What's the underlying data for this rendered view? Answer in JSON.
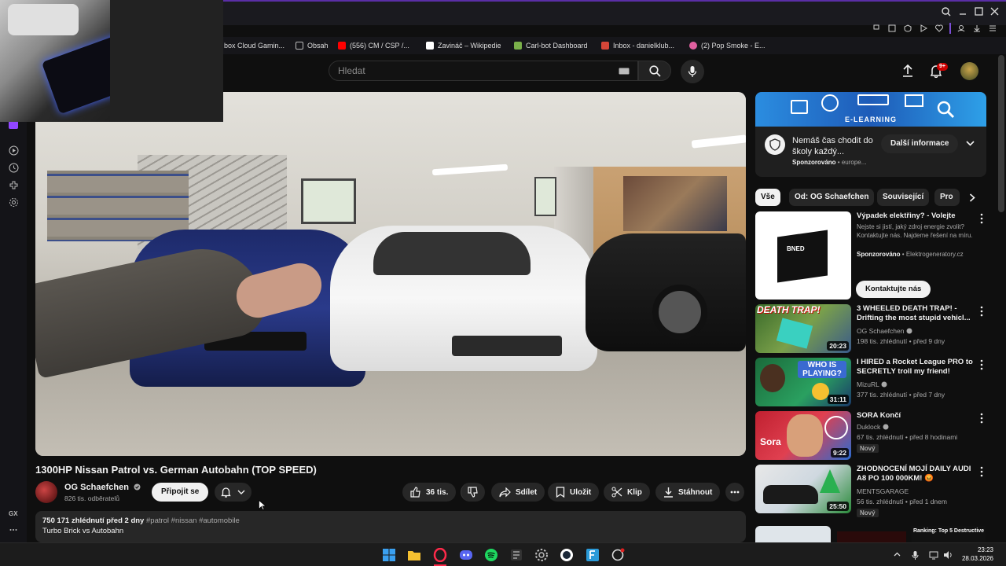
{
  "bookmarks": [
    {
      "label": "box Cloud Gamin...",
      "color": "#3a7d3a"
    },
    {
      "label": "Obsah",
      "color": "#bbbbbb"
    },
    {
      "label": "(556) CM / CSP /...",
      "color": "#ff0000"
    },
    {
      "label": "Zavináč – Wikipedie",
      "color": "#ffffff"
    },
    {
      "label": "Carl-bot Dashboard",
      "color": "#7ab04a"
    },
    {
      "label": "Inbox - danielklub...",
      "color": "#d44638"
    },
    {
      "label": "(2) Pop Smoke - E...",
      "color": "#e060a0"
    }
  ],
  "header": {
    "search_placeholder": "Hledat",
    "notifications_count": "9+"
  },
  "rail_bottom_label": "GX",
  "video": {
    "title": "1300HP Nissan Patrol vs. German Autobahn (TOP SPEED)",
    "channel": "OG Schaefchen",
    "subscribers": "826 tis. odběratelů",
    "join_label": "Připojit se",
    "likes": "36 tis.",
    "share_label": "Sdílet",
    "save_label": "Uložit",
    "clip_label": "Klip",
    "download_label": "Stáhnout",
    "stats": "750 171 zhlédnutí  před 2 dny",
    "hashtags": "#patrol #nissan #automobile",
    "description": "Turbo Brick vs Autobahn"
  },
  "ad": {
    "banner_text": "E-LEARNING",
    "title": "Nemáš čas chodit do školy každý...",
    "sponsored": "Sponzorováno",
    "domain": "europe...",
    "cta": "Další informace"
  },
  "chips": [
    "Vše",
    "Od: OG Schaefchen",
    "Související",
    "Pro"
  ],
  "sponsored_card": {
    "title": "Výpadek elektřiny? - Volejte",
    "body": "Nejste si jistí, jaký zdroj energie zvolit? Kontaktujte nás. Najdeme řešení na míru.",
    "sponsored": "Sponzorováno",
    "domain": "Elektrogeneratory.cz",
    "cta": "Kontaktujte nás",
    "thumb_text": "BNED"
  },
  "recommendations": [
    {
      "title": "3 WHEELED DEATH TRAP! - Drifting the most stupid vehicl...",
      "channel": "OG Schaefchen",
      "meta": "198 tis. zhlédnutí • před 9 dny",
      "duration": "20:23",
      "thumb_text": "DEATH TRAP!",
      "new": ""
    },
    {
      "title": "I HIRED a Rocket League PRO to SECRETLY troll my friend!",
      "channel": "MizuRL",
      "meta": "377 tis. zhlédnutí • před 7 dny",
      "duration": "31:11",
      "thumb_text": "WHO IS PLAYING?",
      "new": ""
    },
    {
      "title": "SORA Končí",
      "channel": "Duklock",
      "meta": "67 tis. zhlédnutí • před 8 hodinami",
      "duration": "9:22",
      "thumb_text": "Sora",
      "new": "Nový"
    },
    {
      "title": "ZHODNOCENÍ MOJÍ DAILY AUDI A8 PO 100 000KM! 😡",
      "channel": "MENTSGARAGE",
      "meta": "56 tis. zhlédnutí • před 1 dnem",
      "duration": "25:50",
      "thumb_text": "",
      "new": "Nový"
    }
  ],
  "partial_thumb_text": "Ranking: Top 5 Destructive",
  "taskbar": {
    "time": "23:23",
    "date": "28.03.2026"
  }
}
